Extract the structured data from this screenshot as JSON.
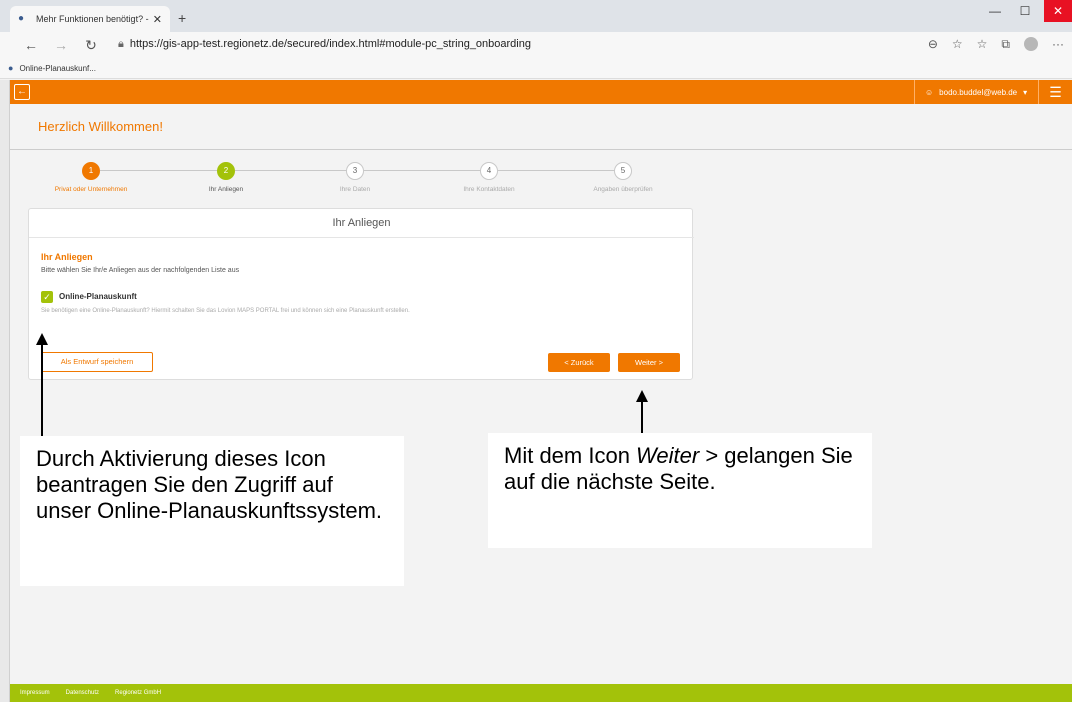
{
  "browser": {
    "tab_title": "Mehr Funktionen benötigt? - He",
    "url": "https://gis-app-test.regionetz.de/secured/index.html#module-pc_string_onboarding",
    "favorite": "Online-Planauskunf..."
  },
  "app": {
    "user": "bodo.buddel@web.de",
    "page_title": "Herzlich Willkommen!"
  },
  "steps": [
    {
      "num": "1",
      "label": "Privat oder Unternehmen"
    },
    {
      "num": "2",
      "label": "Ihr Anliegen"
    },
    {
      "num": "3",
      "label": "Ihre Daten"
    },
    {
      "num": "4",
      "label": "Ihre Kontaktdaten"
    },
    {
      "num": "5",
      "label": "Angaben überprüfen"
    }
  ],
  "card": {
    "title": "Ihr Anliegen",
    "section_title": "Ihr Anliegen",
    "section_sub": "Bitte wählen Sie Ihr/e Anliegen aus der nachfolgenden Liste aus",
    "checkbox_label": "Online-Planauskunft",
    "checkbox_desc": "Sie benötigen eine Online-Planauskunft? Hiermit schalten Sie das Lovion MAPS PORTAL frei und können sich eine Planauskunft erstellen.",
    "draft_button": "Als Entwurf speichern",
    "back_button": "< Zurück",
    "next_button": "Weiter >"
  },
  "annotations": {
    "left": "Durch Aktivierung dieses Icon beantragen Sie den Zugriff auf unser Online-Planauskunftssystem.",
    "right_pre": "Mit dem Icon ",
    "right_em": "Weiter",
    "right_post": " > gelangen Sie auf die nächste Seite."
  },
  "footer": [
    "Impressum",
    "Datenschutz",
    "Regionetz GmbH"
  ]
}
